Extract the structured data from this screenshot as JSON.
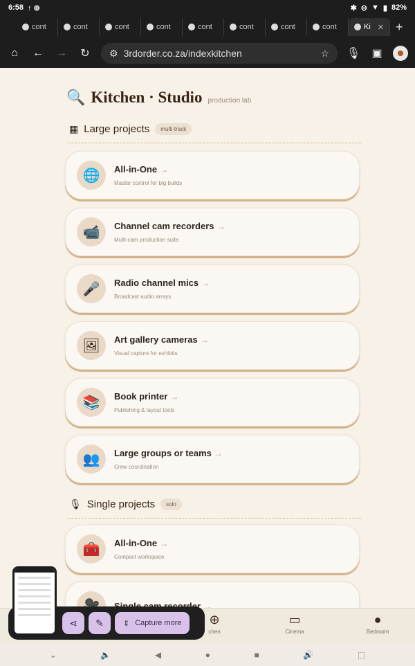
{
  "status_bar": {
    "time": "6:58",
    "left_icons": "↑ ⊕",
    "battery": "82%"
  },
  "tabs": [
    {
      "label": "cont"
    },
    {
      "label": "cont"
    },
    {
      "label": "cont"
    },
    {
      "label": "cont"
    },
    {
      "label": "cont"
    },
    {
      "label": "cont"
    },
    {
      "label": "cont"
    },
    {
      "label": "cont"
    },
    {
      "label": "Ki",
      "active": true
    }
  ],
  "address_bar": {
    "url": "3rdorder.co.za/indexkitchen"
  },
  "page": {
    "title": "Kitchen · Studio",
    "subtitle": "production lab",
    "large_section": {
      "title": "Large projects",
      "badge": "multi-track"
    },
    "large_cards": [
      {
        "title": "All-in-One",
        "desc": "Master control for big builds",
        "icon": "globe-icon"
      },
      {
        "title": "Channel cam recorders",
        "desc": "Multi-cam production suite",
        "icon": "video-camera-icon"
      },
      {
        "title": "Radio channel mics",
        "desc": "Broadcast audio arrays",
        "icon": "microphone-icon"
      },
      {
        "title": "Art gallery cameras",
        "desc": "Visual capture for exhibits",
        "icon": "framed-picture-icon"
      },
      {
        "title": "Book printer",
        "desc": "Publishing & layout tools",
        "icon": "books-icon"
      },
      {
        "title": "Large groups or teams",
        "desc": "Crew coordination",
        "icon": "people-icon"
      }
    ],
    "single_section": {
      "title": "Single projects",
      "badge": "solo"
    },
    "single_cards": [
      {
        "title": "All-in-One",
        "desc": "Compact workspace",
        "icon": "toolbox-icon"
      },
      {
        "title": "Single cam recorder",
        "desc": "",
        "icon": "camera-icon"
      }
    ]
  },
  "bottom_nav": [
    {
      "label": "chen",
      "icon": "plus-icon"
    },
    {
      "label": "Cinema",
      "icon": "monitor-icon"
    },
    {
      "label": "Bedroom",
      "icon": "person-icon"
    }
  ],
  "screenshot_toolbar": {
    "capture_label": "Capture more"
  }
}
